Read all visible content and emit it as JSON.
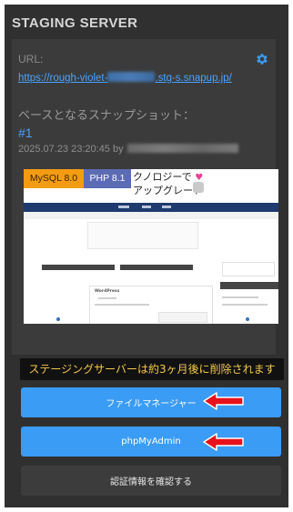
{
  "panel": {
    "title": "STAGING SERVER",
    "url_label": "URL:",
    "url_prefix": "https://rough-violet-",
    "url_suffix": ".stg-s.snapup.jp/",
    "snapshot_heading": "ベースとなるスナップショット：",
    "snapshot_number": "#1",
    "snapshot_date": "2025.07.23 23:20:45 by",
    "icons": {
      "settings": "gear-icon"
    }
  },
  "preview": {
    "mysql_badge": "MySQL 8.0",
    "php_badge": "PHP 8.1",
    "site_title_line1": "クノロジーで",
    "site_title_line2": "アップグレード",
    "post_title": "WordPress"
  },
  "notice": "ステージングサーバーは約3ヶ月後に削除されます",
  "buttons": {
    "file_manager": "ファイルマネージャー",
    "phpmyadmin": "phpMyAdmin",
    "confirm_auth": "認証情報を確認する"
  },
  "colors": {
    "accent": "#3b9cf5",
    "link": "#4aa3ff",
    "notice_text": "#f2c94c",
    "mysql_badge": "#f39c12",
    "php_badge": "#5b6bb4",
    "arrow": "#e8111b"
  }
}
